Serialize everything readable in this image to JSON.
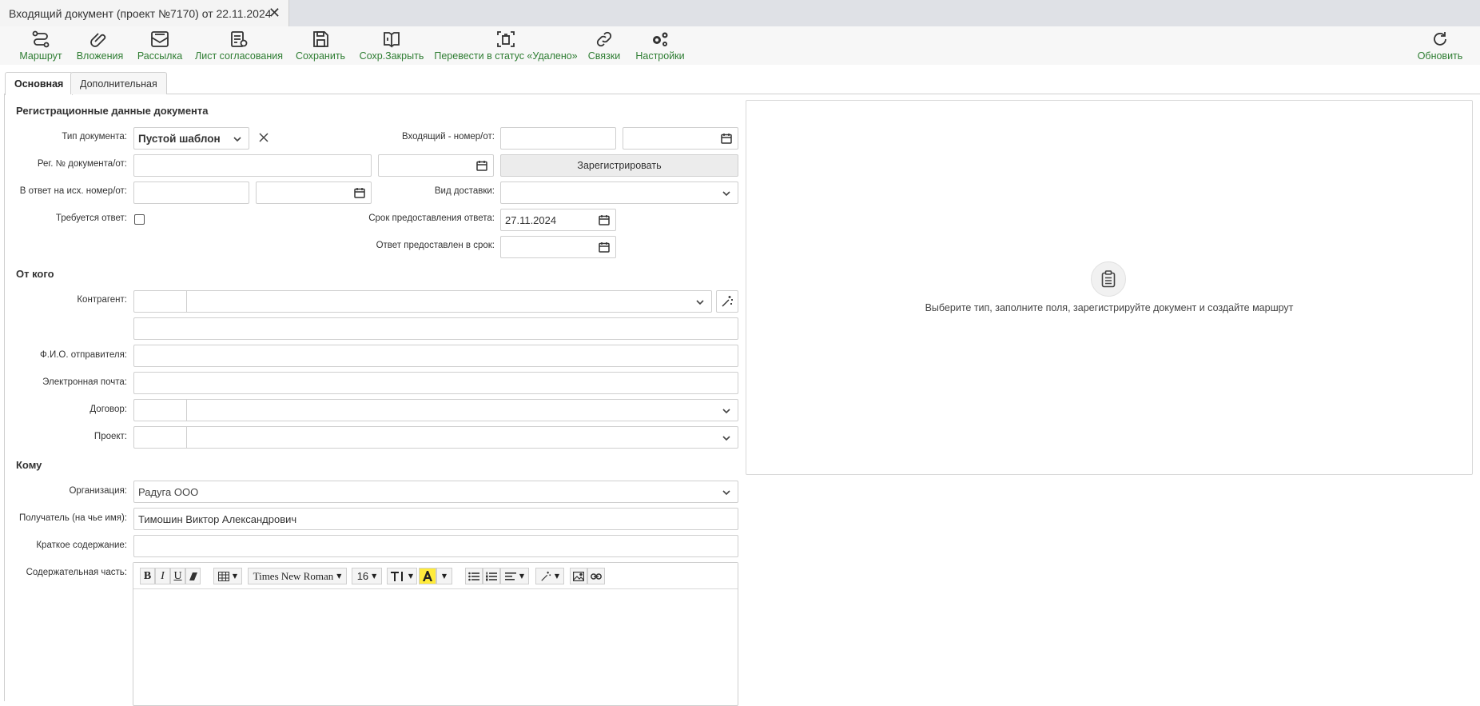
{
  "window": {
    "tab_title": "Входящий документ (проект №7170) от 22.11.2024",
    "close_symbol": "✕"
  },
  "toolbar": {
    "route": "Маршрут",
    "attachments": "Вложения",
    "mailing": "Рассылка",
    "approval_sheet": "Лист согласования",
    "save": "Сохранить",
    "save_close": "Сохр.Закрыть",
    "mark_deleted": "Перевести в статус «Удалено»",
    "links": "Связки",
    "settings": "Настройки",
    "refresh": "Обновить",
    "accent_color": "#2e7d32"
  },
  "tabs": {
    "main": "Основная",
    "additional": "Дополнительная"
  },
  "registration": {
    "title": "Регистрационные данные документа",
    "doc_type_label": "Тип документа:",
    "doc_type_value": "Пустой шаблон",
    "incoming_label": "Входящий - номер/от:",
    "reg_no_label": "Рег. № документа/от:",
    "register_button": "Зарегистрировать",
    "reply_to_label": "В ответ на исх. номер/от:",
    "delivery_label": "Вид доставки:",
    "reply_required_label": "Требуется ответ:",
    "reply_required_checked": false,
    "reply_deadline_label": "Срок предоставления ответа:",
    "reply_deadline_value": "27.11.2024",
    "reply_given_label": "Ответ предоставлен в срок:"
  },
  "from": {
    "title": "От кого",
    "counterparty_label": "Контрагент:",
    "sender_label": "Ф.И.О. отправителя:",
    "email_label": "Электронная почта:",
    "contract_label": "Договор:",
    "project_label": "Проект:"
  },
  "to": {
    "title": "Кому",
    "org_label": "Организация:",
    "org_value": "Радуга ООО",
    "recipient_label": "Получатель (на чье имя):",
    "recipient_value": "Тимошин Виктор Александрович",
    "summary_label": "Краткое содержание:",
    "content_label": "Содержательная часть:"
  },
  "editor": {
    "bold": "B",
    "italic": "I",
    "underline": "U",
    "font_family": "Times New Roman",
    "font_size": "16"
  },
  "route_panel": {
    "hint": "Выберите тип, заполните поля, зарегистрируйте документ и создайте маршрут"
  }
}
